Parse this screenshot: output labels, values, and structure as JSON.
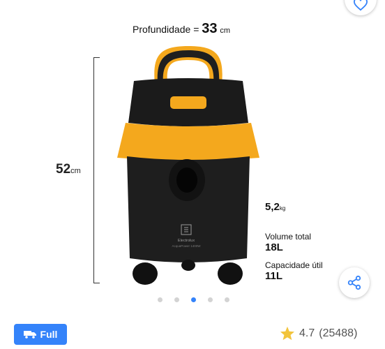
{
  "favorite": {
    "icon": "heart-icon"
  },
  "dimensions": {
    "depth_label": "Profundidade",
    "equals": "=",
    "depth_value": "33",
    "depth_unit": "cm",
    "height_value": "52",
    "height_unit": "cm"
  },
  "product": {
    "brand_mark": "Electrolux",
    "model_text": "AcquaPower 1400W",
    "colors": {
      "body": "#1b1b1b",
      "accent": "#f4a81d"
    }
  },
  "specs": {
    "weight_value": "5,2",
    "weight_unit": "kg",
    "volume_title": "Volume total",
    "volume_value": "18L",
    "capacity_title": "Capacidade útil",
    "capacity_value": "11L"
  },
  "share": {
    "icon": "share-icon"
  },
  "carousel": {
    "count": 5,
    "active_index": 2
  },
  "badge": {
    "label": "Full",
    "icon": "truck-icon"
  },
  "rating": {
    "score": "4.7",
    "count": "(25488)",
    "icon": "star-icon"
  }
}
